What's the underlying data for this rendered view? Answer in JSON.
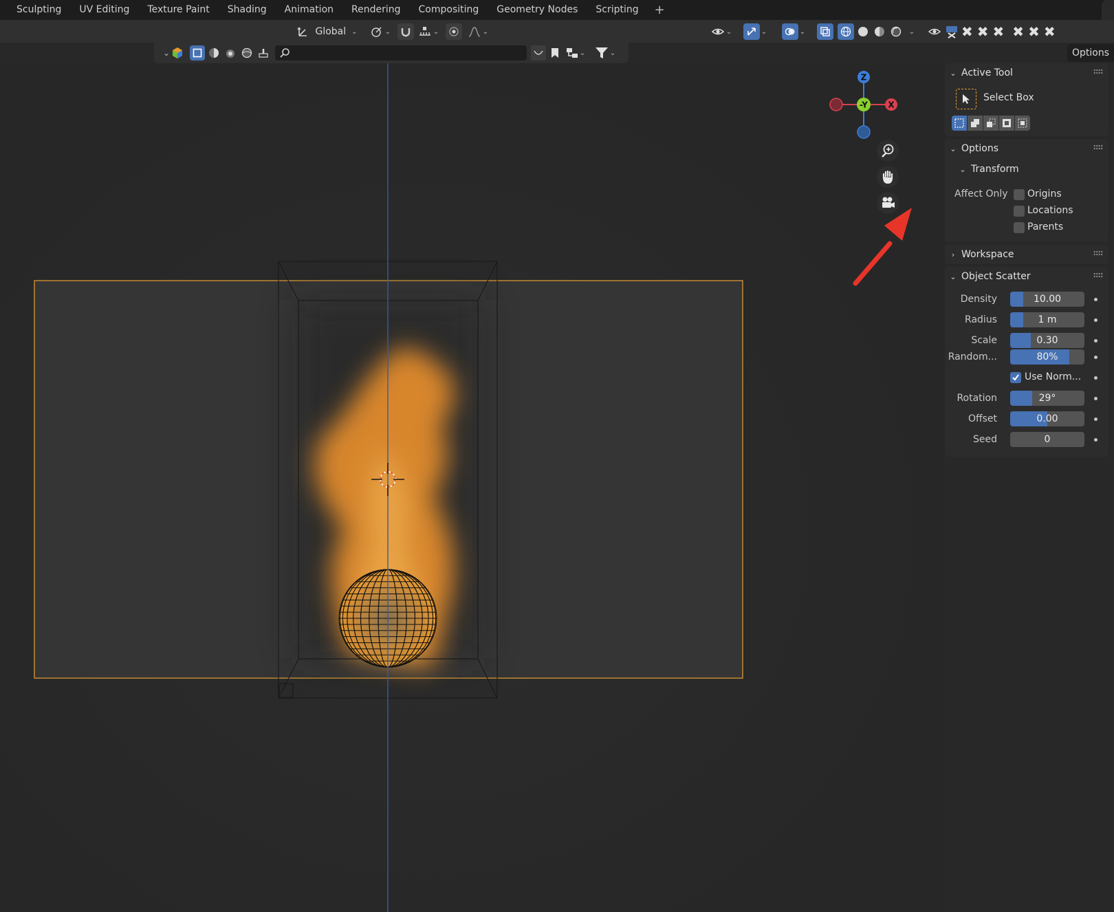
{
  "workspace_tabs": [
    "Sculpting",
    "UV Editing",
    "Texture Paint",
    "Shading",
    "Animation",
    "Rendering",
    "Compositing",
    "Geometry Nodes",
    "Scripting"
  ],
  "add_tab_label": "+",
  "header": {
    "transform_orientation": "Global"
  },
  "options_button": "Options",
  "sidebar": {
    "active_tool": {
      "title": "Active Tool",
      "tool_name": "Select Box"
    },
    "options": {
      "title": "Options",
      "transform_title": "Transform",
      "affect_only_label": "Affect Only",
      "checkboxes": [
        {
          "label": "Origins",
          "checked": false
        },
        {
          "label": "Locations",
          "checked": false
        },
        {
          "label": "Parents",
          "checked": false
        }
      ]
    },
    "workspace": {
      "title": "Workspace"
    },
    "object_scatter": {
      "title": "Object Scatter",
      "density": {
        "label": "Density",
        "value": "10.00",
        "fill": 0.18
      },
      "radius": {
        "label": "Radius",
        "value": "1 m",
        "fill": 0.18
      },
      "scale": {
        "label": "Scale",
        "value": "0.30",
        "fill": 0.28
      },
      "random": {
        "label": "Random...",
        "value": "80%",
        "fill": 0.8
      },
      "use_normal": {
        "label": "Use Norm...",
        "checked": true
      },
      "rotation": {
        "label": "Rotation",
        "value": "29°",
        "fill": 0.3
      },
      "offset": {
        "label": "Offset",
        "value": "0.00",
        "fill": 0.5
      },
      "seed": {
        "label": "Seed",
        "value": "0",
        "fill": 0
      }
    }
  },
  "gizmo": {
    "z_label": "Z",
    "y_label": "-Y",
    "x_label": "X"
  },
  "colors": {
    "accent_blue": "#4772b3",
    "selection_orange": "#e8a033",
    "axis_x": "#d9414f",
    "axis_y": "#8bd12e",
    "axis_z": "#3c7ed9",
    "annotation_red": "#e8352a"
  }
}
